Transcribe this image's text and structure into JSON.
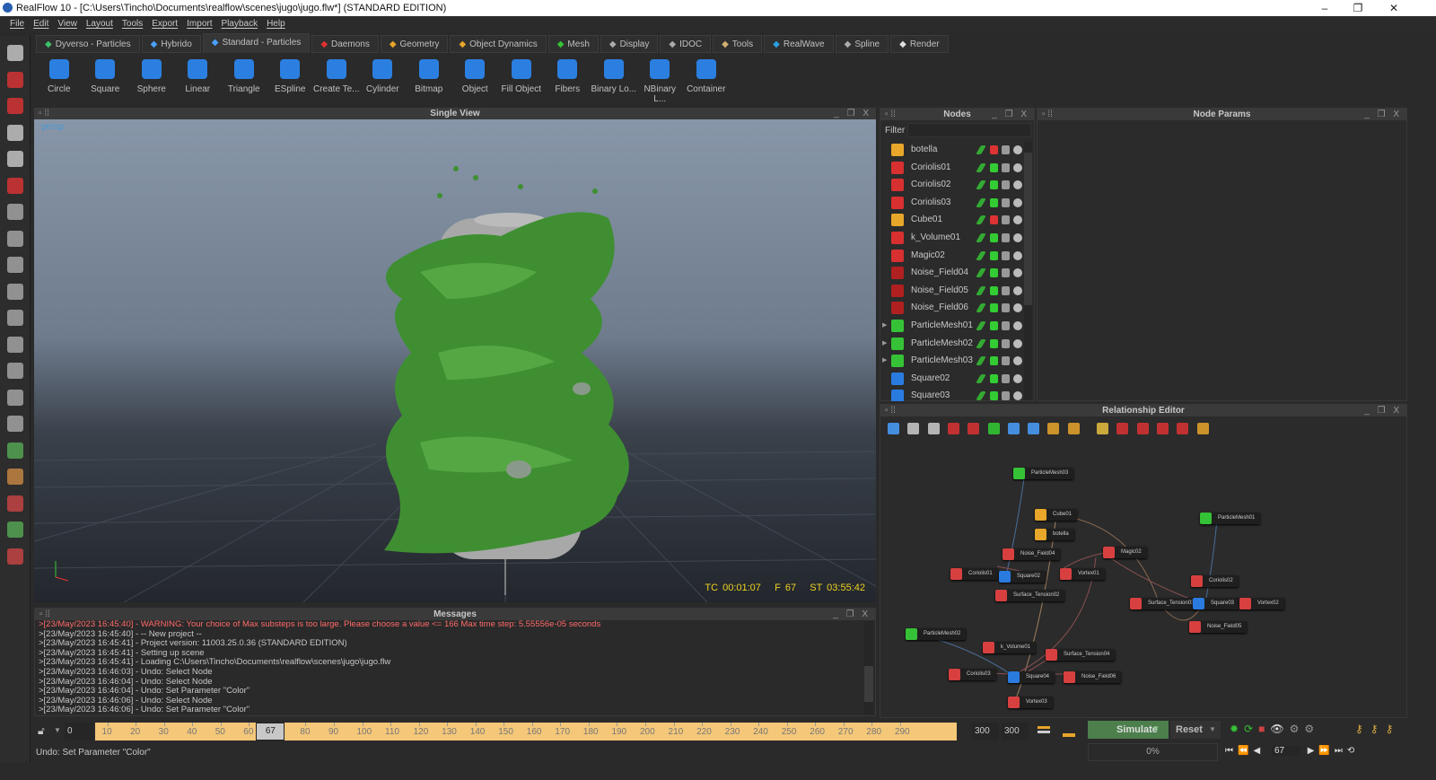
{
  "window": {
    "title": "RealFlow 10 - [C:\\Users\\Tincho\\Documents\\realflow\\scenes\\jugo\\jugo.flw*] (STANDARD EDITION)",
    "minimize": "–",
    "restore": "❐",
    "close": "✕"
  },
  "menu": [
    "File",
    "Edit",
    "View",
    "Layout",
    "Tools",
    "Export",
    "Import",
    "Playback",
    "Help"
  ],
  "tabs": [
    {
      "label": "Dyverso - Particles",
      "icon": "dyverso-icon",
      "color": "#3cc06a"
    },
    {
      "label": "Hybrido",
      "icon": "hybrido-icon",
      "color": "#4aa0ff"
    },
    {
      "label": "Standard - Particles",
      "icon": "particles-icon",
      "color": "#4aa0ff",
      "active": true
    },
    {
      "label": "Daemons",
      "icon": "daemon-icon",
      "color": "#e03030"
    },
    {
      "label": "Geometry",
      "icon": "cube-icon",
      "color": "#e8a62a"
    },
    {
      "label": "Object Dynamics",
      "icon": "dynamics-icon",
      "color": "#e8a62a"
    },
    {
      "label": "Mesh",
      "icon": "mesh-icon",
      "color": "#36c236"
    },
    {
      "label": "Display",
      "icon": "display-icon",
      "color": "#aaaaaa"
    },
    {
      "label": "IDOC",
      "icon": "idoc-icon",
      "color": "#aaaaaa"
    },
    {
      "label": "Tools",
      "icon": "tools-icon",
      "color": "#d0b070"
    },
    {
      "label": "RealWave",
      "icon": "realwave-icon",
      "color": "#2aa0e0"
    },
    {
      "label": "Spline",
      "icon": "spline-icon",
      "color": "#aaaaaa"
    },
    {
      "label": "Render",
      "icon": "render-icon",
      "color": "#dddddd"
    }
  ],
  "toolbar": [
    "Circle",
    "Square",
    "Sphere",
    "Linear",
    "Triangle",
    "ESpline",
    "Create Te...",
    "Cylinder",
    "Bitmap",
    "Object",
    "Fill Object",
    "Fibers",
    "Binary Lo...",
    "NBinary L...",
    "Container"
  ],
  "viewport": {
    "title": "Single View",
    "camera": "persp",
    "tc": "TC 00:01:07",
    "frame": "F 67",
    "st": "ST 03:55:42",
    "fluid_color": "#3f8f32"
  },
  "nodes": {
    "title": "Nodes",
    "filter_label": "Filter",
    "filter_value": "",
    "items": [
      {
        "name": "botella",
        "type": "geometry",
        "color": "#e8a62a",
        "cache": "red"
      },
      {
        "name": "Coriolis01",
        "type": "daemon",
        "color": "#d83030",
        "cache": "green"
      },
      {
        "name": "Coriolis02",
        "type": "daemon",
        "color": "#d83030",
        "cache": "green"
      },
      {
        "name": "Coriolis03",
        "type": "daemon",
        "color": "#d83030",
        "cache": "green"
      },
      {
        "name": "Cube01",
        "type": "geometry",
        "color": "#e8a62a",
        "cache": "red"
      },
      {
        "name": "k_Volume01",
        "type": "daemon",
        "color": "#d83030",
        "cache": "green"
      },
      {
        "name": "Magic02",
        "type": "daemon",
        "color": "#d83030",
        "cache": "green"
      },
      {
        "name": "Noise_Field04",
        "type": "daemon",
        "color": "#b02020",
        "cache": "green"
      },
      {
        "name": "Noise_Field05",
        "type": "daemon",
        "color": "#b02020",
        "cache": "green"
      },
      {
        "name": "Noise_Field06",
        "type": "daemon",
        "color": "#b02020",
        "cache": "green"
      },
      {
        "name": "ParticleMesh01",
        "type": "mesh",
        "color": "#36c236",
        "cache": "green",
        "expandable": true
      },
      {
        "name": "ParticleMesh02",
        "type": "mesh",
        "color": "#36c236",
        "cache": "green",
        "expandable": true
      },
      {
        "name": "ParticleMesh03",
        "type": "mesh",
        "color": "#36c236",
        "cache": "green",
        "expandable": true
      },
      {
        "name": "Square02",
        "type": "emitter",
        "color": "#2a7be0",
        "cache": "green"
      },
      {
        "name": "Square03",
        "type": "emitter",
        "color": "#2a7be0",
        "cache": "green"
      }
    ]
  },
  "node_params": {
    "title": "Node Params"
  },
  "relationship": {
    "title": "Relationship Editor",
    "nodes": [
      "ParticleMesh03",
      "Cube01",
      "botella",
      "Noise_Field04",
      "Magic02",
      "Coriolis01",
      "Square02",
      "Vortex01",
      "Surface_Tension02",
      "ParticleMesh01",
      "Coriolis02",
      "Surface_Tension03",
      "Square03",
      "Vortex02",
      "Noise_Field05",
      "ParticleMesh02",
      "k_Volume01",
      "Surface_Tension04",
      "Coriolis03",
      "Square04",
      "Noise_Field06",
      "Vortex03"
    ]
  },
  "messages": {
    "title": "Messages",
    "lines": [
      {
        "text": ">[23/May/2023 16:45:40] - WARNING: Your choice of Max substeps is too large. Please choose a value <= 166 Max time step: 5.55556e-05 seconds",
        "level": "warning"
      },
      {
        "text": ">[23/May/2023 16:45:40] - -- New project --"
      },
      {
        "text": ">[23/May/2023 16:45:41] - Project version: 11003.25.0.36 (STANDARD EDITION)"
      },
      {
        "text": ">[23/May/2023 16:45:41] - Setting up scene"
      },
      {
        "text": ">[23/May/2023 16:45:41] -  Loading C:\\Users\\Tincho\\Documents\\realflow\\scenes\\jugo\\jugo.flw"
      },
      {
        "text": ">[23/May/2023 16:46:03] - Undo: Select Node"
      },
      {
        "text": ">[23/May/2023 16:46:04] - Undo: Select Node"
      },
      {
        "text": ">[23/May/2023 16:46:04] - Undo: Set Parameter \"Color\""
      },
      {
        "text": ">[23/May/2023 16:46:06] - Undo: Select Node"
      },
      {
        "text": ">[23/May/2023 16:46:06] - Undo: Set Parameter \"Color\""
      }
    ]
  },
  "timeline": {
    "start": "0",
    "current": "67",
    "end_a": "300",
    "end_b": "300",
    "ticks": [
      "10",
      "20",
      "30",
      "40",
      "50",
      "60",
      "80",
      "90",
      "100",
      "110",
      "120",
      "130",
      "140",
      "150",
      "160",
      "170",
      "180",
      "190",
      "200",
      "210",
      "220",
      "230",
      "240",
      "250",
      "260",
      "270",
      "280",
      "290"
    ],
    "max_frame": 300
  },
  "status": "Undo: Set Parameter \"Color\"",
  "controls": {
    "simulate": "Simulate",
    "reset": "Reset",
    "progress": "0%",
    "frame": "67"
  }
}
